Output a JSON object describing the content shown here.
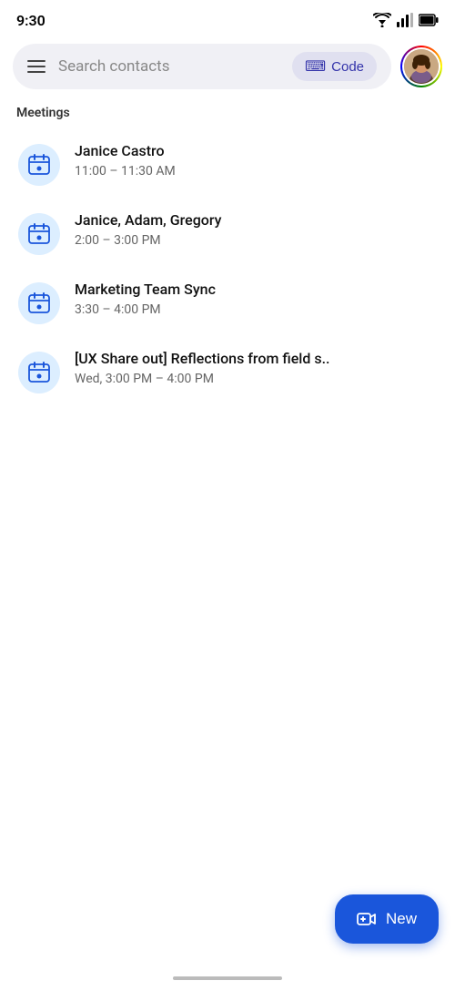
{
  "statusBar": {
    "time": "9:30"
  },
  "searchBar": {
    "placeholder": "Search contacts",
    "codeLabel": "Code"
  },
  "sections": {
    "meetings": {
      "label": "Meetings",
      "items": [
        {
          "title": "Janice Castro",
          "time": "11:00 – 11:30 AM"
        },
        {
          "title": "Janice, Adam, Gregory",
          "time": "2:00 – 3:00 PM"
        },
        {
          "title": "Marketing Team Sync",
          "time": "3:30 – 4:00 PM"
        },
        {
          "title": "[UX Share out] Reflections from field s..",
          "time": "Wed, 3:00 PM –  4:00 PM"
        }
      ]
    }
  },
  "fab": {
    "label": "New"
  }
}
